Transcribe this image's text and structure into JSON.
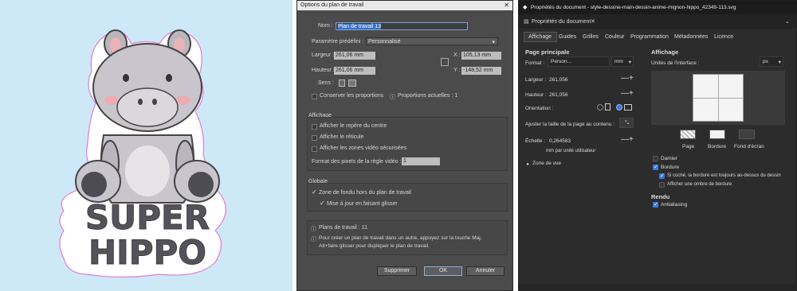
{
  "artwork": {
    "title_line1": "SUPER",
    "title_line2": "HIPPO"
  },
  "artboard_dialog": {
    "title": "Options du plan de travail",
    "name_label": "Nom :",
    "name_value": "Plan de travail 13",
    "preset_label": "Paramètre prédéfini :",
    "preset_value": "Personnalisé",
    "width_label": "Largeur :",
    "width_value": "261,06 mm",
    "height_label": "Hauteur :",
    "height_value": "261,06 mm",
    "x_label": "X :",
    "x_value": "105,13 mm",
    "y_label": "Y :",
    "y_value": "-148,52 mm",
    "orientation_label": "Sens :",
    "keep_proportions": "Conserver les proportions",
    "current_proportions": "Proportions actuelles : 1",
    "display_section": "Affichage",
    "show_center": "Afficher le repère du centre",
    "show_cross": "Afficher le réticule",
    "show_video_safe": "Afficher les zones vidéo sécurisées",
    "pixel_ratio_label": "Format des pixels de la règle vidéo :",
    "pixel_ratio_value": "1",
    "global_section": "Globale",
    "fade_outside": "Zone de fondu hors du plan de travail",
    "update_drag": "Mise à jour en faisant glisser",
    "artboards_count": "Plans de travail : 11",
    "info_text_1": "Pour créer un plan de travail dans un autre, appuyez sur la touche Maj.",
    "info_text_2": "Alt+faire glisser pour dupliquer le plan de travail.",
    "delete_button": "Supprimer",
    "ok_button": "OK",
    "cancel_button": "Annuler"
  },
  "doc_props": {
    "window_title": "Propriétés du document - style-dessine-main-dessin-anime-mignon-hippo_42349-113.svg",
    "panel_tab": "Propriétés du document",
    "tabs": [
      "Affichage",
      "Guides",
      "Grilles",
      "Couleur",
      "Programmation",
      "Métadonnées",
      "Licence"
    ],
    "main_page": "Page principale",
    "format_label": "Format :",
    "format_value": "Person...",
    "format_unit": "mm",
    "width_label": "Largeur :",
    "width_value": "261,056",
    "height_label": "Hauteur :",
    "height_value": "261,056",
    "orientation_label": "Orientation :",
    "fit_label": "Ajuster la taille de la page au contenu :",
    "scale_label": "Échelle :",
    "scale_value": "0,264583",
    "scale_unit": "mm par unité utilisateur",
    "viewbox": "Zone de vue",
    "display_heading": "Affichage",
    "ui_units_label": "Unités de l'interface :",
    "ui_units_value": "px",
    "swatch_page": "Page",
    "swatch_border": "Bordure",
    "swatch_desk": "Fond d'écran",
    "checkerboard": "Damier",
    "border": "Bordure",
    "border_on_top": "Si coché, la bordure est toujours au-dessus du dessin",
    "border_shadow": "Afficher une ombre de bordure",
    "render_heading": "Rendu",
    "antialias": "Antialiasing"
  }
}
